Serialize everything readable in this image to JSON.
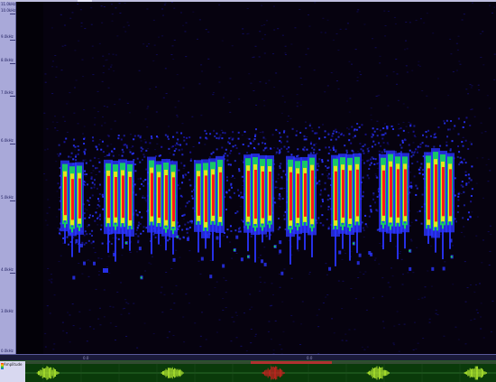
{
  "frequency_axis": {
    "labels": [
      "11.0kHz",
      "10.0kHz",
      "9.0kHz",
      "8.0kHz",
      "7.0kHz",
      "6.0kHz",
      "5.0kHz",
      "4.0kHz",
      "3.0kHz",
      "0.0kHz"
    ]
  },
  "time_axis": {
    "labels": [
      "0.0",
      "0.0"
    ]
  },
  "waveform": {
    "amplitude_label": "Amplitude"
  },
  "colors": {
    "background": "#06020f",
    "noise": "#1a14a0",
    "low": "#2a34ff",
    "mid": "#18d060",
    "high_mid": "#e8e020",
    "peak": "#ff1818",
    "waveform_bg": "#0a3a0a",
    "waveform": "#b8f030",
    "waveform_highlight": "#d02020"
  }
}
